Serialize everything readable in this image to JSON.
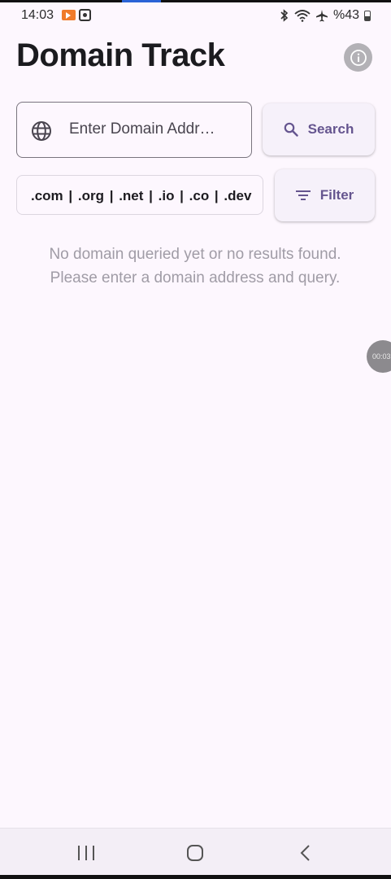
{
  "status_bar": {
    "time": "14:03",
    "battery": "%43",
    "icons": [
      "screen-record-icon",
      "screenshot-icon",
      "bluetooth-icon",
      "wifi-icon",
      "airplane-icon",
      "battery-icon"
    ]
  },
  "header": {
    "title": "Domain Track",
    "info_icon": "info-icon"
  },
  "search": {
    "placeholder": "Enter Domain Addr…",
    "value": "",
    "button_label": "Search",
    "button_icon": "search-icon",
    "input_icon": "globe-icon"
  },
  "tld_filter": {
    "text": ".com |  .org |  .net |  .io |  .co |  .dev",
    "button_label": "Filter",
    "button_icon": "filter-icon"
  },
  "empty_state": {
    "line1": "No domain queried yet or no results found.",
    "line2": "Please enter a domain address and query."
  },
  "timer_bubble": {
    "text": "00:03"
  },
  "colors": {
    "background": "#fdf7fe",
    "accent": "#65558f",
    "muted_text": "#a09ca6",
    "title": "#1b1b1f"
  },
  "nav_bar": {
    "icons": [
      "recent-apps-icon",
      "home-icon",
      "back-icon"
    ]
  }
}
